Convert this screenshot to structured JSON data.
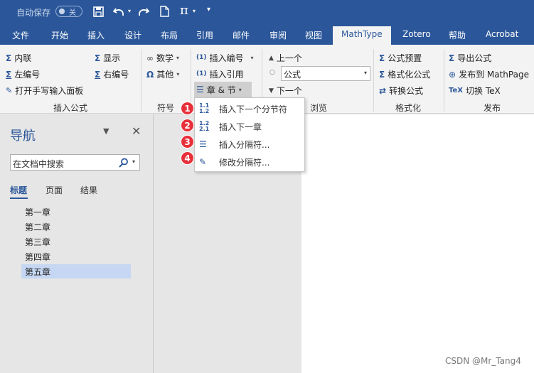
{
  "titlebar": {
    "autosave_label": "自动保存",
    "autosave_state": "关",
    "icons": [
      "save-icon",
      "undo-icon",
      "redo-icon",
      "new-document-icon",
      "pi-icon",
      "customize-icon"
    ],
    "pi_symbol": "π"
  },
  "tabs": [
    "文件",
    "开始",
    "插入",
    "设计",
    "布局",
    "引用",
    "邮件",
    "审阅",
    "视图",
    "MathType",
    "Zotero",
    "帮助",
    "Acrobat"
  ],
  "active_tab": "MathType",
  "ribbon": {
    "insert_equation": {
      "inline": "内联",
      "display": "显示",
      "left_number": "左编号",
      "right_number": "右编号",
      "handwriting_panel": "打开手写输入面板",
      "group_label": "插入公式"
    },
    "symbols": {
      "math": "数学",
      "other": "其他",
      "group_label": "符号"
    },
    "numbers": {
      "insert_number": "插入编号",
      "insert_reference": "插入引用",
      "chapter_section": "章 & 节"
    },
    "browse": {
      "previous": "上一个",
      "equation_select_value": "公式",
      "next": "下一个",
      "group_label": "浏览"
    },
    "format": {
      "equation_preset": "公式预置",
      "format_equations": "格式化公式",
      "convert_equations": "转换公式",
      "group_label": "格式化"
    },
    "publish": {
      "export_equations": "导出公式",
      "publish_to_mathpage": "发布到 MathPage",
      "toggle_tex": "切换 TeX",
      "group_label": "发布"
    }
  },
  "dropdown": {
    "items": [
      {
        "badge": "1",
        "label": "插入下一个分节符",
        "icon_text": "1.1\n1.2"
      },
      {
        "badge": "2",
        "label": "插入下一章",
        "icon_text": "1.2\n2.1"
      },
      {
        "badge": "3",
        "label": "插入分隔符...",
        "icon_text": ""
      },
      {
        "badge": "4",
        "label": "修改分隔符...",
        "icon_text": ""
      }
    ]
  },
  "navigation": {
    "title": "导航",
    "search_placeholder": "在文档中搜索",
    "tabs": [
      "标题",
      "页面",
      "结果"
    ],
    "active_tab": "标题",
    "headings": [
      "第一章",
      "第二章",
      "第三章",
      "第四章",
      "第五章"
    ],
    "selected_heading": "第五章"
  },
  "watermark": "CSDN @Mr_Tang4",
  "colors": {
    "accent": "#2b579a",
    "badge": "#e8303a",
    "selection": "#c5d7f2"
  }
}
